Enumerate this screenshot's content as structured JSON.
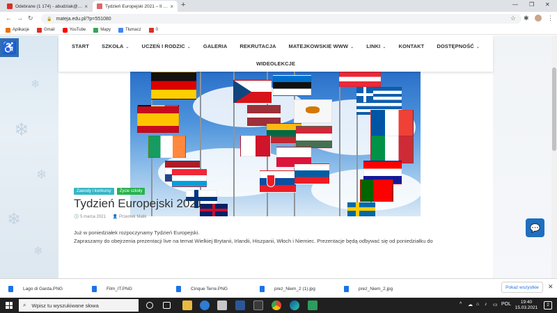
{
  "browser": {
    "tabs": [
      {
        "title": "Odebrane (1 174) - abudziak@m...",
        "close": "×",
        "favicon_color": "#d93025"
      },
      {
        "title": "Tydzień Europejski 2021 – II Lice...",
        "close": "×",
        "favicon_color": "#e06666"
      }
    ],
    "new_tab": "+",
    "window_controls": {
      "minimize": "—",
      "maximize": "❐",
      "close": "✕"
    },
    "nav": {
      "back": "←",
      "forward": "→",
      "reload": "↻"
    },
    "url": "mateja.edu.pl/?p=551080",
    "lock": "🔒",
    "star": "☆",
    "extensions_icon": "✱",
    "menu_icon": "⋮"
  },
  "bookmarks": [
    {
      "label": "Aplikacje",
      "color": "#e8710a"
    },
    {
      "label": "Gmail",
      "color": "#d93025"
    },
    {
      "label": "YouTube",
      "color": "#ff0000"
    },
    {
      "label": "Mapy",
      "color": "#34a853"
    },
    {
      "label": "Tłumacz",
      "color": "#4285f4"
    },
    {
      "label": "0",
      "color": "#d93025"
    }
  ],
  "site": {
    "menu_row1": [
      {
        "label": "START",
        "dropdown": false
      },
      {
        "label": "SZKOŁA",
        "dropdown": true
      },
      {
        "label": "UCZEŃ I RODZIC",
        "dropdown": true
      },
      {
        "label": "GALERIA",
        "dropdown": false
      },
      {
        "label": "REKRUTACJA",
        "dropdown": false
      },
      {
        "label": "MATEJKOWSKIE WWW",
        "dropdown": true
      },
      {
        "label": "LINKI",
        "dropdown": true
      },
      {
        "label": "KONTAKT",
        "dropdown": false
      },
      {
        "label": "DOSTĘPNOŚĆ",
        "dropdown": true
      }
    ],
    "menu_row2": [
      {
        "label": "WIDEOLEKCJE",
        "dropdown": false
      }
    ],
    "caret": "⌄",
    "accessibility_icon": "♿",
    "chat_icon": "💬"
  },
  "post": {
    "categories": [
      "Zawody i konkursy",
      "Życie szkoły"
    ],
    "title": "Tydzień Europejski 2021",
    "date": "5 marca 2021",
    "author": "Przemek Malik",
    "paragraph1": "Już w poniedziałek rozpoczynamy Tydzień Europejski.",
    "paragraph2": "Zapraszamy do obejrzenia prezentacji live na temat Wielkiej Brytanii, Irlandii, Hiszpanii, Włoch i Niemiec. Prezentacje będą odbywać się od poniedziałku do"
  },
  "downloads": {
    "files": [
      "Lago di Garda.PNG",
      "Film_IT.PNG",
      "Cinque Terre.PNG",
      "prez_Niem_2 (1).jpg",
      "prez_Niem_2.jpg"
    ],
    "show_all": "Pokaż wszystkie",
    "close": "✕"
  },
  "taskbar": {
    "search_placeholder": "Wpisz tu wyszukiwane słowa",
    "search_icon": "⌕",
    "tray_language": "POL",
    "time": "19:40",
    "date": "15.03.2021",
    "notifications": "2"
  }
}
